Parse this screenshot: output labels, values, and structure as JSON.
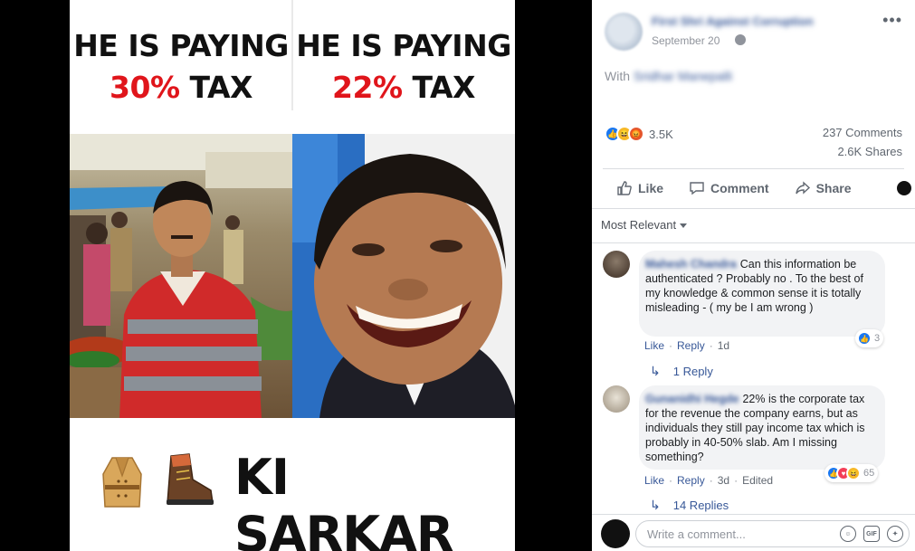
{
  "meme": {
    "left_caption": {
      "line1": "HE IS PAYING",
      "percent": "30%",
      "suffix": "TAX"
    },
    "right_caption": {
      "line1": "HE IS PAYING",
      "percent": "22%",
      "suffix": "TAX"
    },
    "bottom_text": "KI SARKAR",
    "emojis": [
      "coat-emoji",
      "hiking-boot-emoji"
    ]
  },
  "post": {
    "author": "First Shri Against Corruption",
    "date": "September 20",
    "with_prefix": "With",
    "with_name": "Sridhar Manepalli",
    "reaction_count": "3.5K",
    "comments_count": "237 Comments",
    "shares_count": "2.6K Shares",
    "actions": {
      "like": "Like",
      "comment": "Comment",
      "share": "Share"
    },
    "sort_label": "Most Relevant"
  },
  "comments": [
    {
      "author": "Mahesh Chandra",
      "text": "Can this information be authenticated ? Probably no . To the best of my knowledge & common sense it is totally misleading - ( my be I am wrong )",
      "like": "Like",
      "reply": "Reply",
      "time": "1d",
      "reaction_count": "3",
      "replies_label": "1 Reply"
    },
    {
      "author": "Gunanidhi Hegde",
      "text": "22% is the corporate tax for the revenue the company earns, but as individuals they still pay income tax which is probably in 40-50% slab. Am I missing something?",
      "like": "Like",
      "reply": "Reply",
      "time": "3d",
      "edited": "Edited",
      "reaction_count": "65",
      "replies_label": "14 Replies"
    }
  ],
  "composer": {
    "placeholder": "Write a comment...",
    "gif_label": "GIF"
  },
  "colors": {
    "link": "#385898",
    "accent_red": "#e0151b",
    "fb_blue": "#1877f2"
  }
}
